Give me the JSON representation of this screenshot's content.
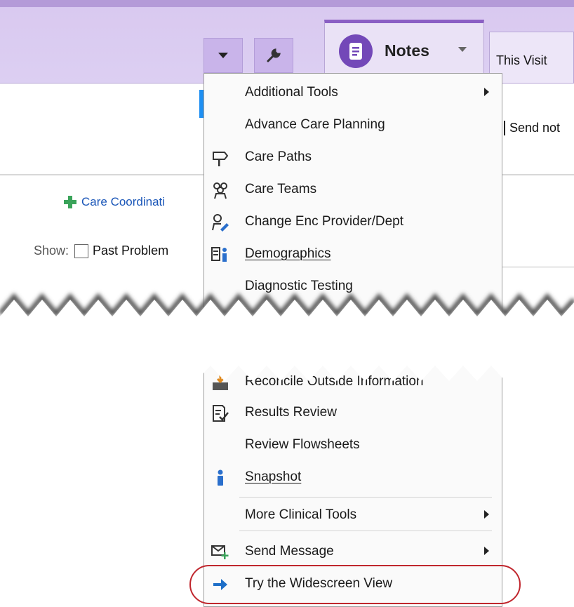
{
  "header": {
    "notes_tab_label": "Notes",
    "visit_tab_label": "This Visit",
    "send_notes_fragment": "Send not"
  },
  "left_panel": {
    "care_coordination_link": "Care Coordinati",
    "show_label": "Show:",
    "past_problems_label": "Past Problem"
  },
  "menu": {
    "top_items": [
      {
        "label": "Additional Tools",
        "icon": "none",
        "submenu": true
      },
      {
        "label": "Advance Care Planning",
        "icon": "none",
        "submenu": false
      },
      {
        "label": "Care Paths",
        "icon": "signpost-icon",
        "submenu": false
      },
      {
        "label": "Care Teams",
        "icon": "team-icon",
        "submenu": false
      },
      {
        "label": "Change Enc Provider/Dept",
        "icon": "provider-edit-icon",
        "submenu": false
      },
      {
        "label": "Demographics",
        "icon": "demographics-icon",
        "submenu": false
      },
      {
        "label": "Diagnostic Testing",
        "icon": "none",
        "submenu": false
      }
    ],
    "bottom_items": [
      {
        "label": "Reconcile Outside Information",
        "icon": "inbox-arrow-icon",
        "submenu": false
      },
      {
        "label": "Results Review",
        "icon": "results-review-icon",
        "submenu": false
      },
      {
        "label": "Review Flowsheets",
        "icon": "none",
        "submenu": false
      },
      {
        "label": "Snapshot",
        "icon": "person-icon",
        "submenu": false
      },
      {
        "label": "More Clinical Tools",
        "icon": "none",
        "submenu": true
      },
      {
        "label": "Send Message",
        "icon": "message-add-icon",
        "submenu": true
      },
      {
        "label": "Try the Widescreen View",
        "icon": "arrow-right-icon",
        "submenu": false
      }
    ]
  },
  "colors": {
    "header_purple": "#dccff2",
    "accent_purple": "#7348b8",
    "link_blue": "#1a56b8",
    "plus_green": "#3aa35a",
    "highlight_red": "#c0262d",
    "arrow_blue": "#1e6fc8"
  }
}
